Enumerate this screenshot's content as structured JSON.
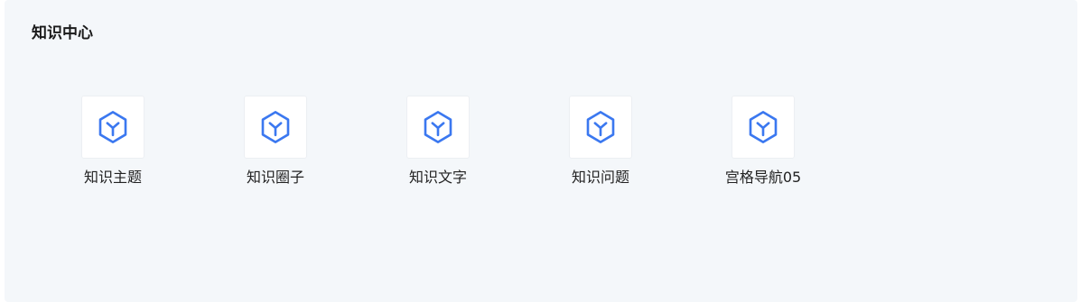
{
  "panel": {
    "title": "知识中心"
  },
  "nav_items": [
    {
      "label": "知识主题",
      "icon": "cube-icon"
    },
    {
      "label": "知识圈子",
      "icon": "cube-icon"
    },
    {
      "label": "知识文字",
      "icon": "cube-icon"
    },
    {
      "label": "知识问题",
      "icon": "cube-icon"
    },
    {
      "label": "宫格导航05",
      "icon": "cube-icon"
    }
  ],
  "colors": {
    "panel_background": "#f4f7fa",
    "icon_accent": "#3b78f0",
    "icon_tile": "#ffffff",
    "title_text": "#1a1a1a",
    "label_text": "#222222"
  }
}
